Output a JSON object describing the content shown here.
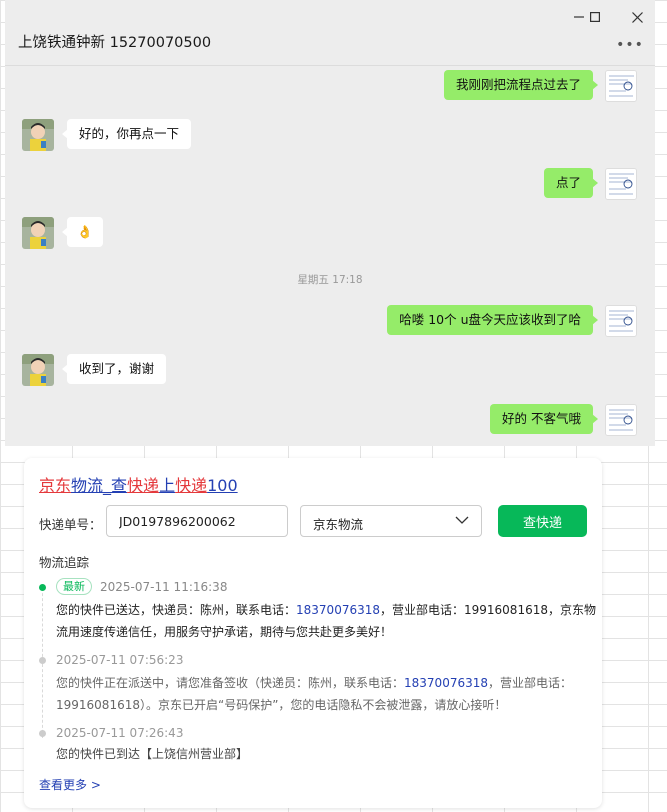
{
  "chat": {
    "title": "上饶铁通钟新 15270070500",
    "window_controls": {
      "minimize": "—",
      "maximize": "☐",
      "close": "✕"
    },
    "more_label": "•••",
    "timestamp": "星期五 17:18",
    "messages": [
      {
        "side": "mine",
        "text": "我刚刚把流程点过去了"
      },
      {
        "side": "theirs",
        "text": "好的，你再点一下"
      },
      {
        "side": "mine",
        "text": "点了"
      },
      {
        "side": "theirs",
        "text": "👌"
      },
      {
        "side": "mine",
        "text": "哈喽  10个 u盘今天应该收到了哈"
      },
      {
        "side": "theirs",
        "text": "收到了，谢谢"
      },
      {
        "side": "mine",
        "text": "好的 不客气哦"
      }
    ]
  },
  "express": {
    "title_parts": [
      "京东",
      "物流",
      "_查",
      "快递",
      "上",
      "快递",
      "100"
    ],
    "tracking_label": "快递单号：",
    "tracking_value": "JD0197896200062",
    "carrier": "京东物流",
    "query_button": "查快递",
    "section_title": "物流追踪",
    "latest_badge": "最新",
    "events": [
      {
        "time": "2025-07-11 11:16:38",
        "desc_pre": "您的快件已送达，快递员：陈州，联系电话：",
        "phone": "18370076318",
        "desc_post": "，营业部电话：19916081618，京东物流用速度传递信任，用服务守护承诺，期待与您共赴更多美好！"
      },
      {
        "time": "2025-07-11 07:56:23",
        "desc_pre": "您的快件正在派送中，请您准备签收（快递员：陈州，联系电话：",
        "phone": "18370076318",
        "desc_post": "，营业部电话：19916081618）。京东已开启“号码保护”，您的电话隐私不会被泄露，请放心接听！"
      },
      {
        "time": "2025-07-11 07:26:43",
        "desc_pre": "您的快件已到达【上饶信州营业部】",
        "phone": "",
        "desc_post": ""
      }
    ],
    "see_more": "查看更多 >"
  },
  "colors": {
    "chat_bg": "#ededed",
    "bubble_mine": "#95ec69",
    "bubble_theirs": "#ffffff",
    "accent_green": "#07b859",
    "link_blue": "#2440b3",
    "brand_red": "#e4393c"
  }
}
